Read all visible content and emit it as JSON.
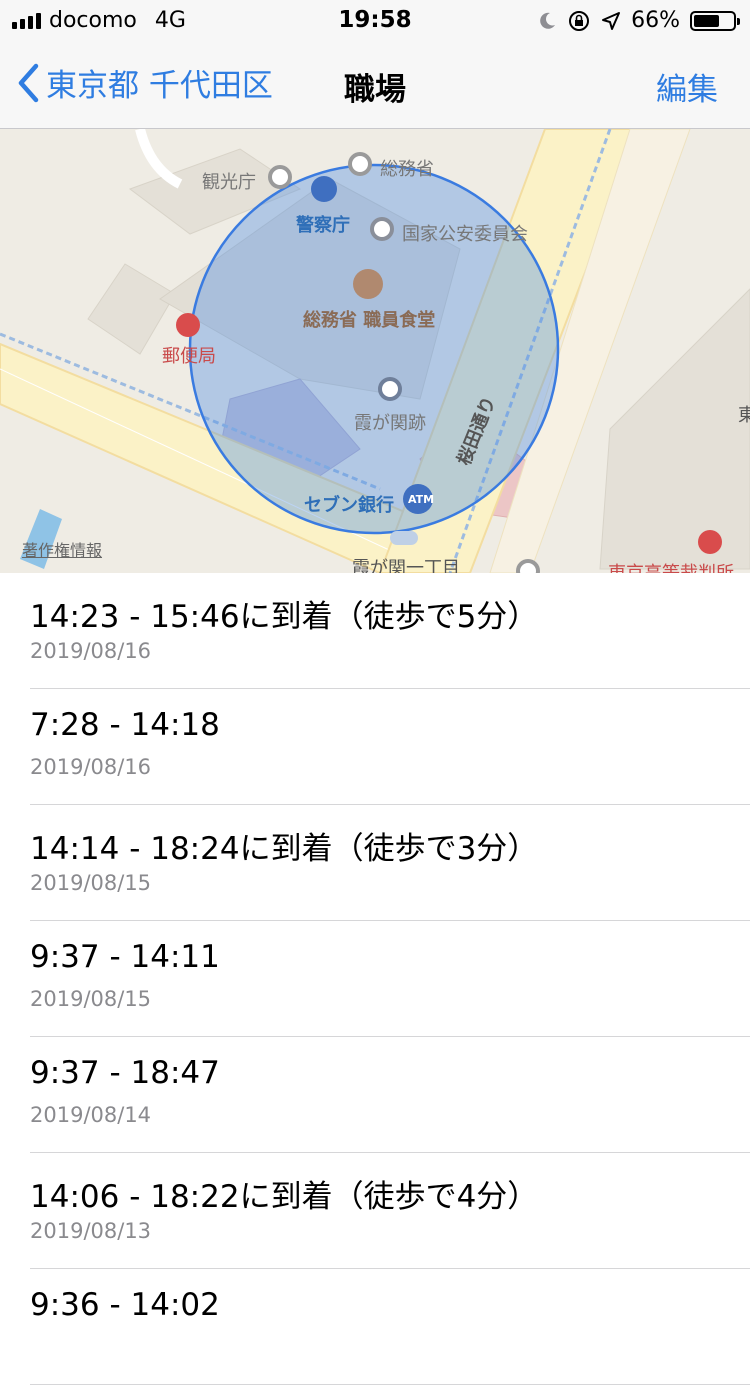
{
  "status_bar": {
    "carrier": "docomo",
    "network": "4G",
    "time": "19:58",
    "battery": "66%",
    "battery_level": 0.66
  },
  "nav": {
    "back_label": "東京都 千代田区",
    "title": "職場",
    "edit_label": "編集"
  },
  "map": {
    "labels": {
      "kankocho": "観光庁",
      "somusho": "総務省",
      "keisatsucho": "警察庁",
      "kokka_koan": "国家公安委員会",
      "shokudo": "総務省 職員食堂",
      "yubinkyoku": "郵便局",
      "kasumigaseki_seki": "霞が関跡",
      "street": "桜田通り",
      "seven_bank": "セブン銀行",
      "atm": "ATM",
      "station": "霞が関一丁目",
      "court": "東京高等裁判所",
      "edge": "東",
      "copyright": "著作権情報"
    },
    "region_color": "#4f8ee6"
  },
  "visits": [
    {
      "time": "14:23 - 15:46に到着（徒歩で5分）",
      "date": "2019/08/16"
    },
    {
      "time": "7:28 - 14:18",
      "date": "2019/08/16"
    },
    {
      "time": "14:14 - 18:24に到着（徒歩で3分）",
      "date": "2019/08/15"
    },
    {
      "time": "9:37 - 14:11",
      "date": "2019/08/15"
    },
    {
      "time": "9:37 - 18:47",
      "date": "2019/08/14"
    },
    {
      "time": "14:06 - 18:22に到着（徒歩で4分）",
      "date": "2019/08/13"
    },
    {
      "time": "9:36 - 14:02",
      "date": ""
    }
  ]
}
